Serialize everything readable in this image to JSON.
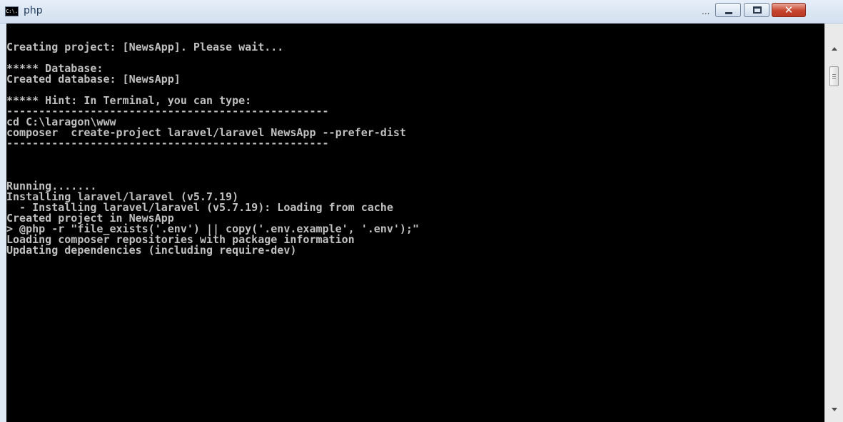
{
  "window": {
    "title": "php",
    "icon_label": "C:\\.",
    "overflow_indicator": "...",
    "buttons": {
      "minimize": "minimize",
      "maximize": "maximize",
      "close": "✕"
    }
  },
  "console": {
    "background": "#000000",
    "text_color": "#c0c0c0",
    "lines": [
      "Creating project: [NewsApp]. Please wait...",
      "",
      "***** Database:",
      "Created database: [NewsApp]",
      "",
      "***** Hint: In Terminal, you can type:",
      "--------------------------------------------------",
      "cd C:\\laragon\\www",
      "composer  create-project laravel/laravel NewsApp --prefer-dist",
      "--------------------------------------------------",
      "",
      "",
      "",
      "Running.......",
      "Installing laravel/laravel (v5.7.19)",
      "  - Installing laravel/laravel (v5.7.19): Loading from cache",
      "Created project in NewsApp",
      "> @php -r \"file_exists('.env') || copy('.env.example', '.env');\"",
      "Loading composer repositories with package information",
      "Updating dependencies (including require-dev)"
    ]
  }
}
